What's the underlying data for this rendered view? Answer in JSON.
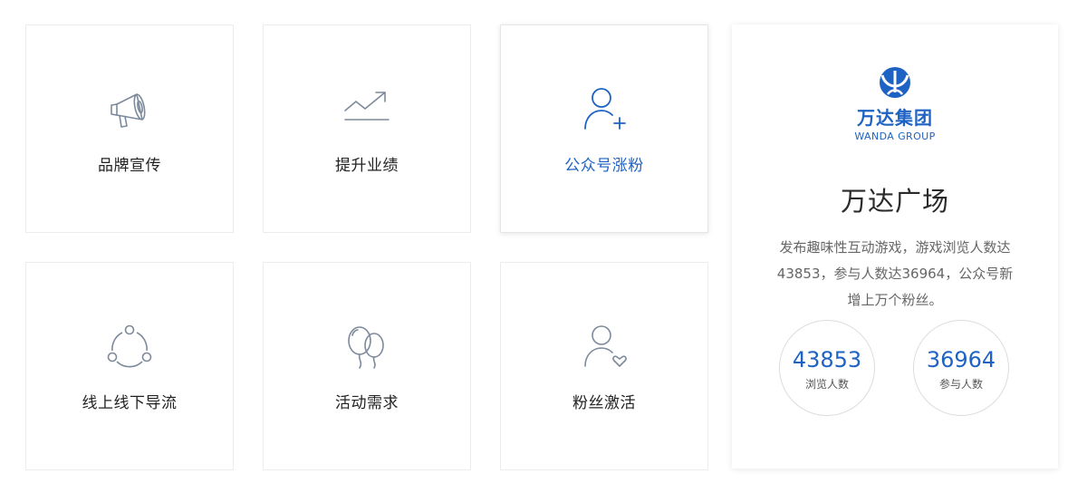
{
  "cards": [
    {
      "label": "品牌宣传",
      "icon": "megaphone-icon"
    },
    {
      "label": "提升业绩",
      "icon": "trend-up-icon"
    },
    {
      "label": "公众号涨粉",
      "icon": "add-user-icon"
    },
    {
      "label": "线上线下导流",
      "icon": "share-nodes-icon"
    },
    {
      "label": "活动需求",
      "icon": "balloons-icon"
    },
    {
      "label": "粉丝激活",
      "icon": "user-heart-icon"
    }
  ],
  "case": {
    "logo_cn": "万达集团",
    "logo_en": "WANDA GROUP",
    "title": "万达广场",
    "description": "发布趣味性互动游戏，游戏浏览人数达43853，参与人数达36964，公众号新增上万个粉丝。",
    "stats": [
      {
        "value": "43853",
        "label": "浏览人数"
      },
      {
        "value": "36964",
        "label": "参与人数"
      }
    ]
  },
  "colors": {
    "accent": "#1e63c4",
    "icon_gray": "#7d8a9b",
    "border": "#ececec"
  }
}
